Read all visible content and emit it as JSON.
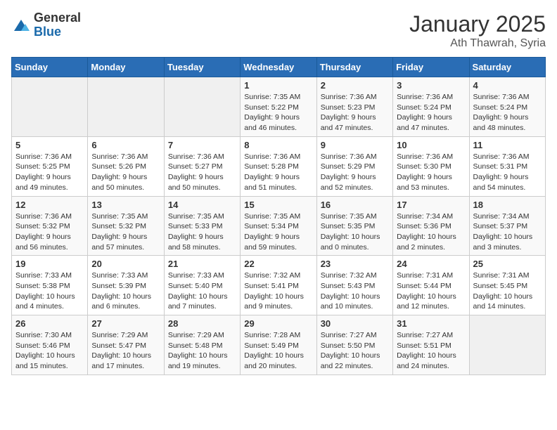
{
  "header": {
    "logo_general": "General",
    "logo_blue": "Blue",
    "month": "January 2025",
    "location": "Ath Thawrah, Syria"
  },
  "days_of_week": [
    "Sunday",
    "Monday",
    "Tuesday",
    "Wednesday",
    "Thursday",
    "Friday",
    "Saturday"
  ],
  "weeks": [
    [
      {
        "day": "",
        "sunrise": "",
        "sunset": "",
        "daylight": ""
      },
      {
        "day": "",
        "sunrise": "",
        "sunset": "",
        "daylight": ""
      },
      {
        "day": "",
        "sunrise": "",
        "sunset": "",
        "daylight": ""
      },
      {
        "day": "1",
        "sunrise": "Sunrise: 7:35 AM",
        "sunset": "Sunset: 5:22 PM",
        "daylight": "Daylight: 9 hours and 46 minutes."
      },
      {
        "day": "2",
        "sunrise": "Sunrise: 7:36 AM",
        "sunset": "Sunset: 5:23 PM",
        "daylight": "Daylight: 9 hours and 47 minutes."
      },
      {
        "day": "3",
        "sunrise": "Sunrise: 7:36 AM",
        "sunset": "Sunset: 5:24 PM",
        "daylight": "Daylight: 9 hours and 47 minutes."
      },
      {
        "day": "4",
        "sunrise": "Sunrise: 7:36 AM",
        "sunset": "Sunset: 5:24 PM",
        "daylight": "Daylight: 9 hours and 48 minutes."
      }
    ],
    [
      {
        "day": "5",
        "sunrise": "Sunrise: 7:36 AM",
        "sunset": "Sunset: 5:25 PM",
        "daylight": "Daylight: 9 hours and 49 minutes."
      },
      {
        "day": "6",
        "sunrise": "Sunrise: 7:36 AM",
        "sunset": "Sunset: 5:26 PM",
        "daylight": "Daylight: 9 hours and 50 minutes."
      },
      {
        "day": "7",
        "sunrise": "Sunrise: 7:36 AM",
        "sunset": "Sunset: 5:27 PM",
        "daylight": "Daylight: 9 hours and 50 minutes."
      },
      {
        "day": "8",
        "sunrise": "Sunrise: 7:36 AM",
        "sunset": "Sunset: 5:28 PM",
        "daylight": "Daylight: 9 hours and 51 minutes."
      },
      {
        "day": "9",
        "sunrise": "Sunrise: 7:36 AM",
        "sunset": "Sunset: 5:29 PM",
        "daylight": "Daylight: 9 hours and 52 minutes."
      },
      {
        "day": "10",
        "sunrise": "Sunrise: 7:36 AM",
        "sunset": "Sunset: 5:30 PM",
        "daylight": "Daylight: 9 hours and 53 minutes."
      },
      {
        "day": "11",
        "sunrise": "Sunrise: 7:36 AM",
        "sunset": "Sunset: 5:31 PM",
        "daylight": "Daylight: 9 hours and 54 minutes."
      }
    ],
    [
      {
        "day": "12",
        "sunrise": "Sunrise: 7:36 AM",
        "sunset": "Sunset: 5:32 PM",
        "daylight": "Daylight: 9 hours and 56 minutes."
      },
      {
        "day": "13",
        "sunrise": "Sunrise: 7:35 AM",
        "sunset": "Sunset: 5:32 PM",
        "daylight": "Daylight: 9 hours and 57 minutes."
      },
      {
        "day": "14",
        "sunrise": "Sunrise: 7:35 AM",
        "sunset": "Sunset: 5:33 PM",
        "daylight": "Daylight: 9 hours and 58 minutes."
      },
      {
        "day": "15",
        "sunrise": "Sunrise: 7:35 AM",
        "sunset": "Sunset: 5:34 PM",
        "daylight": "Daylight: 9 hours and 59 minutes."
      },
      {
        "day": "16",
        "sunrise": "Sunrise: 7:35 AM",
        "sunset": "Sunset: 5:35 PM",
        "daylight": "Daylight: 10 hours and 0 minutes."
      },
      {
        "day": "17",
        "sunrise": "Sunrise: 7:34 AM",
        "sunset": "Sunset: 5:36 PM",
        "daylight": "Daylight: 10 hours and 2 minutes."
      },
      {
        "day": "18",
        "sunrise": "Sunrise: 7:34 AM",
        "sunset": "Sunset: 5:37 PM",
        "daylight": "Daylight: 10 hours and 3 minutes."
      }
    ],
    [
      {
        "day": "19",
        "sunrise": "Sunrise: 7:33 AM",
        "sunset": "Sunset: 5:38 PM",
        "daylight": "Daylight: 10 hours and 4 minutes."
      },
      {
        "day": "20",
        "sunrise": "Sunrise: 7:33 AM",
        "sunset": "Sunset: 5:39 PM",
        "daylight": "Daylight: 10 hours and 6 minutes."
      },
      {
        "day": "21",
        "sunrise": "Sunrise: 7:33 AM",
        "sunset": "Sunset: 5:40 PM",
        "daylight": "Daylight: 10 hours and 7 minutes."
      },
      {
        "day": "22",
        "sunrise": "Sunrise: 7:32 AM",
        "sunset": "Sunset: 5:41 PM",
        "daylight": "Daylight: 10 hours and 9 minutes."
      },
      {
        "day": "23",
        "sunrise": "Sunrise: 7:32 AM",
        "sunset": "Sunset: 5:43 PM",
        "daylight": "Daylight: 10 hours and 10 minutes."
      },
      {
        "day": "24",
        "sunrise": "Sunrise: 7:31 AM",
        "sunset": "Sunset: 5:44 PM",
        "daylight": "Daylight: 10 hours and 12 minutes."
      },
      {
        "day": "25",
        "sunrise": "Sunrise: 7:31 AM",
        "sunset": "Sunset: 5:45 PM",
        "daylight": "Daylight: 10 hours and 14 minutes."
      }
    ],
    [
      {
        "day": "26",
        "sunrise": "Sunrise: 7:30 AM",
        "sunset": "Sunset: 5:46 PM",
        "daylight": "Daylight: 10 hours and 15 minutes."
      },
      {
        "day": "27",
        "sunrise": "Sunrise: 7:29 AM",
        "sunset": "Sunset: 5:47 PM",
        "daylight": "Daylight: 10 hours and 17 minutes."
      },
      {
        "day": "28",
        "sunrise": "Sunrise: 7:29 AM",
        "sunset": "Sunset: 5:48 PM",
        "daylight": "Daylight: 10 hours and 19 minutes."
      },
      {
        "day": "29",
        "sunrise": "Sunrise: 7:28 AM",
        "sunset": "Sunset: 5:49 PM",
        "daylight": "Daylight: 10 hours and 20 minutes."
      },
      {
        "day": "30",
        "sunrise": "Sunrise: 7:27 AM",
        "sunset": "Sunset: 5:50 PM",
        "daylight": "Daylight: 10 hours and 22 minutes."
      },
      {
        "day": "31",
        "sunrise": "Sunrise: 7:27 AM",
        "sunset": "Sunset: 5:51 PM",
        "daylight": "Daylight: 10 hours and 24 minutes."
      },
      {
        "day": "",
        "sunrise": "",
        "sunset": "",
        "daylight": ""
      }
    ]
  ]
}
